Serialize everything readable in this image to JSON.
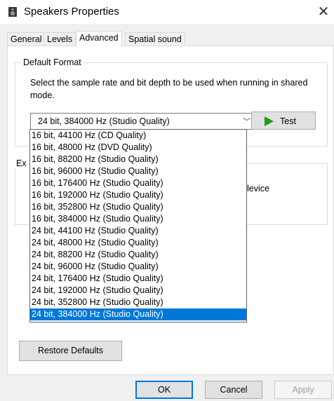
{
  "window": {
    "title": "Speakers Properties",
    "close_glyph": "✕"
  },
  "tabs": [
    {
      "label": "General",
      "active": false
    },
    {
      "label": "Levels",
      "active": false
    },
    {
      "label": "Advanced",
      "active": true
    },
    {
      "label": "Spatial sound",
      "active": false
    }
  ],
  "default_format": {
    "group_title": "Default Format",
    "description_line1": "Select the sample rate and bit depth to be used when running in shared",
    "description_line2": "mode.",
    "selected_value": "24 bit, 384000 Hz (Studio Quality)",
    "test_label": "Test",
    "options": [
      "16 bit, 44100 Hz (CD Quality)",
      "16 bit, 48000 Hz (DVD Quality)",
      "16 bit, 88200 Hz (Studio Quality)",
      "16 bit, 96000 Hz (Studio Quality)",
      "16 bit, 176400 Hz (Studio Quality)",
      "16 bit, 192000 Hz (Studio Quality)",
      "16 bit, 352800 Hz (Studio Quality)",
      "16 bit, 384000 Hz (Studio Quality)",
      "24 bit, 44100 Hz (Studio Quality)",
      "24 bit, 48000 Hz (Studio Quality)",
      "24 bit, 88200 Hz (Studio Quality)",
      "24 bit, 96000 Hz (Studio Quality)",
      "24 bit, 176400 Hz (Studio Quality)",
      "24 bit, 192000 Hz (Studio Quality)",
      "24 bit, 352800 Hz (Studio Quality)",
      "24 bit, 384000 Hz (Studio Quality)"
    ],
    "selected_index": 15
  },
  "exclusive_mode": {
    "title_fragment": "Ex",
    "visible_text_fragment": "levice"
  },
  "restore_defaults_label": "Restore Defaults",
  "footer": {
    "ok": "OK",
    "cancel": "Cancel",
    "apply": "Apply"
  },
  "colors": {
    "accent": "#0078d7",
    "play_icon": "#1a9e1a"
  }
}
